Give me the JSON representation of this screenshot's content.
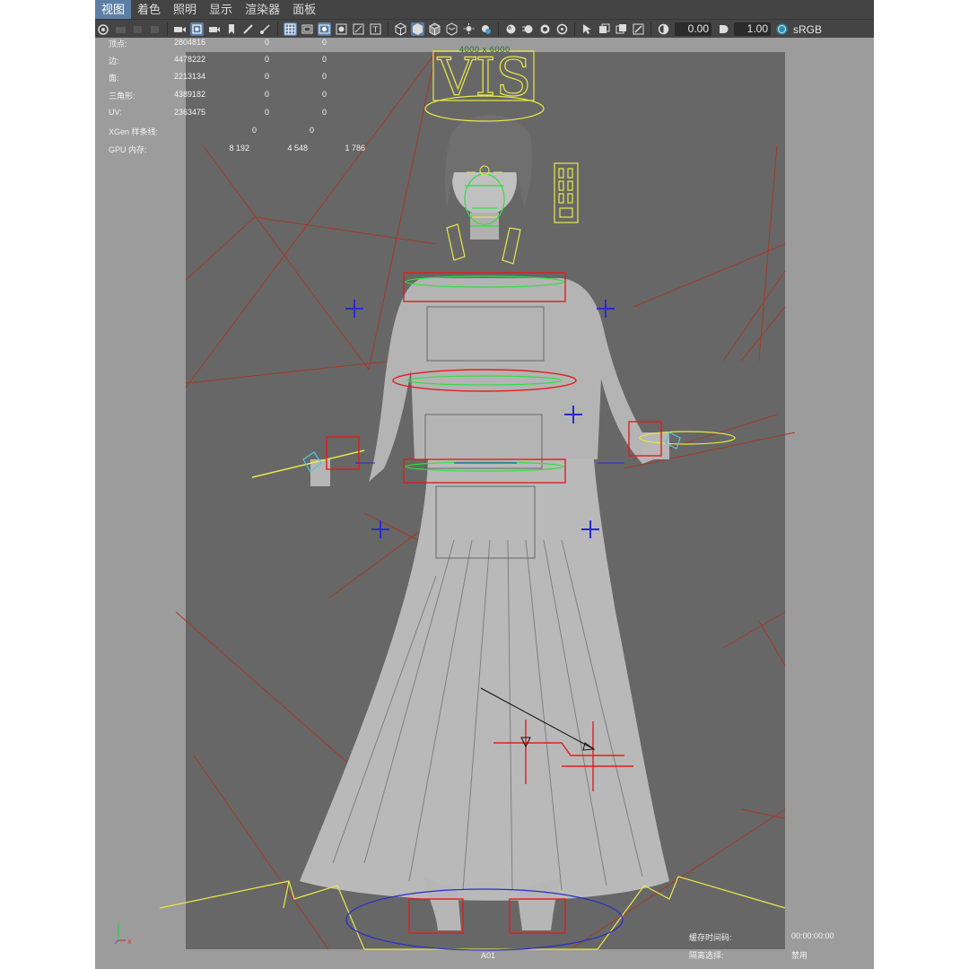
{
  "menu": {
    "items": [
      "视图",
      "着色",
      "照明",
      "显示",
      "渲染器",
      "面板"
    ],
    "active_index": 0
  },
  "toolbar": {
    "exposure_value": "0.00",
    "gamma_value": "1.00",
    "color_space": "sRGB",
    "accent_color": "#5a7da5"
  },
  "hud": {
    "stats": [
      {
        "label": "顶点:",
        "values": [
          "2804816",
          "0",
          "0"
        ]
      },
      {
        "label": "边:",
        "values": [
          "4478222",
          "0",
          "0"
        ]
      },
      {
        "label": "面:",
        "values": [
          "2213134",
          "0",
          "0"
        ]
      },
      {
        "label": "三角形:",
        "values": [
          "4389182",
          "0",
          "0"
        ]
      },
      {
        "label": "UV:",
        "values": [
          "2363475",
          "0",
          "0"
        ]
      }
    ],
    "xgen_label": "XGen 样条线:",
    "xgen_values": [
      "0",
      "0"
    ],
    "gpu_label": "GPU 内存:",
    "gpu_values": [
      "8 192",
      "4 548",
      "1 786"
    ],
    "resolution": "4000 x 6000",
    "camera_name": "A01",
    "cache_label": "缓存时间码:",
    "cache_value": "00:00:00:00",
    "isolate_label": "隔离选择:",
    "isolate_value": "禁用",
    "vis_label": "VIS"
  },
  "colors": {
    "viewport_bg": "#9c9c9c",
    "resolution_gate_bg": "#676767",
    "model": "#b4b4b4",
    "curve_red": "#e21d1d",
    "locator_blue": "#2a2acf",
    "selection_yellow": "#e8e84a",
    "grid_red": "#a33a26"
  }
}
